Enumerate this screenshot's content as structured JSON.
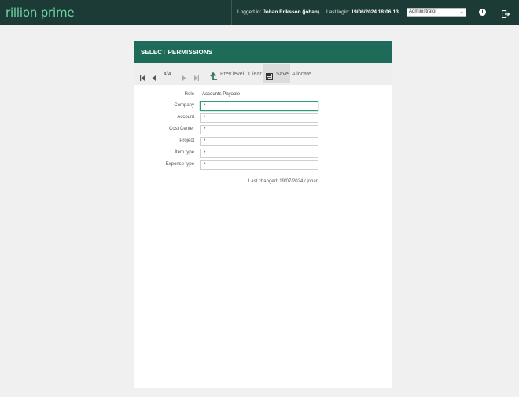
{
  "app": {
    "logo": "rillion prime"
  },
  "header": {
    "logged_in_prefix": "Logged in:",
    "logged_in_user": "Johan Eriksson (johan)",
    "last_login_prefix": "Last login:",
    "last_login_value": "19/06/2024 18:06:13",
    "role_select": "Administrator",
    "icons": [
      "info-icon",
      "logout-icon"
    ]
  },
  "panel": {
    "title": "SELECT PERMISSIONS",
    "toolbar": {
      "pager": "4/4",
      "prev_level": "Prev.level",
      "clear": "Clear",
      "save": "Save",
      "allocate": "Allocate"
    },
    "form": {
      "role_label": "Role",
      "role_value": "Accounts Payable",
      "fields": [
        {
          "label": "Company",
          "value": "*"
        },
        {
          "label": "Account",
          "value": "*"
        },
        {
          "label": "Cost Center",
          "value": "*"
        },
        {
          "label": "Project",
          "value": "*"
        },
        {
          "label": "Item type",
          "value": "*"
        },
        {
          "label": "Expense type",
          "value": "*"
        }
      ],
      "last_changed": "Last changed: 19/07/2024 / johan"
    }
  },
  "colors": {
    "topbar": "#1d3b36",
    "logo": "#6fd6a6",
    "panel_header": "#1e6b5a",
    "focus": "#2e9c75"
  }
}
